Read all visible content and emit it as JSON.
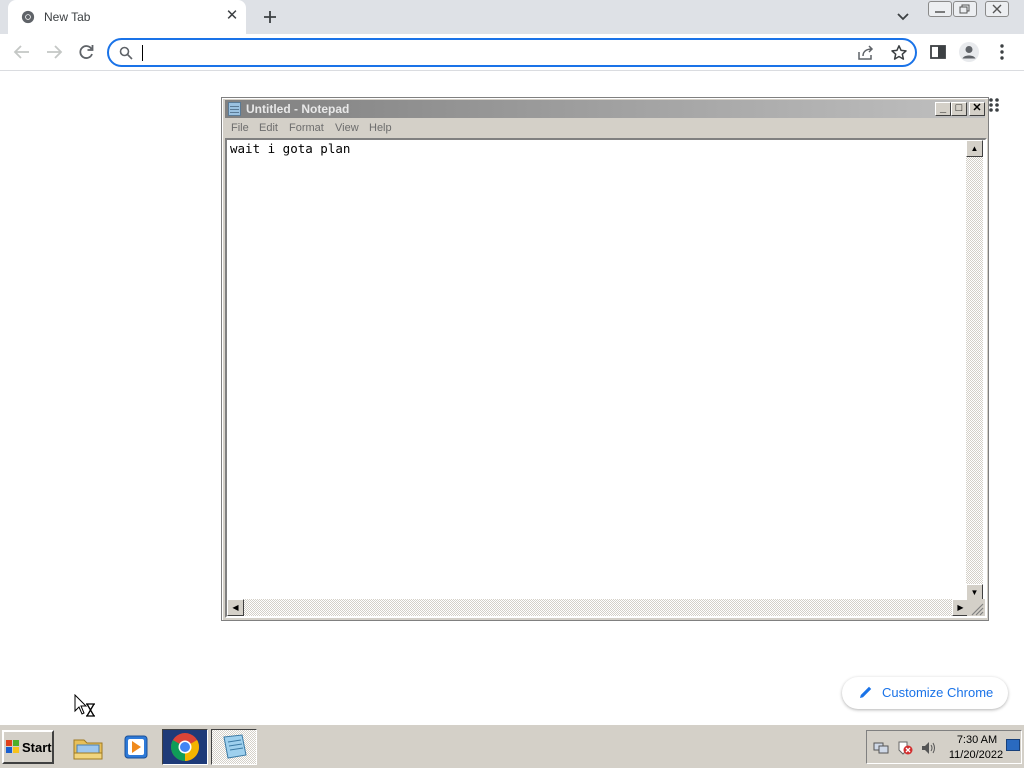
{
  "browser": {
    "tab": {
      "title": "New Tab",
      "favicon": "chrome-icon",
      "close_icon": "close-icon"
    },
    "new_tab_icon": "plus-icon",
    "tab_search_icon": "chevron-down-icon",
    "window_controls": [
      "minimize-icon",
      "restore-icon",
      "close-icon"
    ],
    "toolbar": {
      "back_icon": "back-arrow-icon",
      "forward_icon": "forward-arrow-icon",
      "reload_icon": "reload-icon",
      "omnibox": {
        "value": "",
        "placeholder": "",
        "search_icon": "search-icon",
        "share_icon": "share-icon",
        "bookmark_icon": "star-icon"
      },
      "side_panel_icon": "side-panel-icon",
      "profile_icon": "avatar-icon",
      "menu_icon": "kebab-menu-icon"
    },
    "customize_button": {
      "label": "Customize Chrome",
      "icon": "pencil-icon"
    },
    "accent_color": "#1a73e8"
  },
  "notepad": {
    "title": "Untitled - Notepad",
    "menu": [
      "File",
      "Edit",
      "Format",
      "View",
      "Help"
    ],
    "content": "wait i gota plan",
    "title_buttons": {
      "minimize": "_",
      "maximize": "□",
      "close": "✕"
    }
  },
  "taskbar": {
    "start_label": "Start",
    "quick_launch": [
      "file-explorer-icon",
      "media-player-icon",
      "chrome-icon",
      "notepad-icon"
    ],
    "tray_icons": [
      "network-icon",
      "security-alert-icon",
      "volume-icon"
    ],
    "clock": {
      "time": "7:30 AM",
      "date": "11/20/2022"
    }
  }
}
